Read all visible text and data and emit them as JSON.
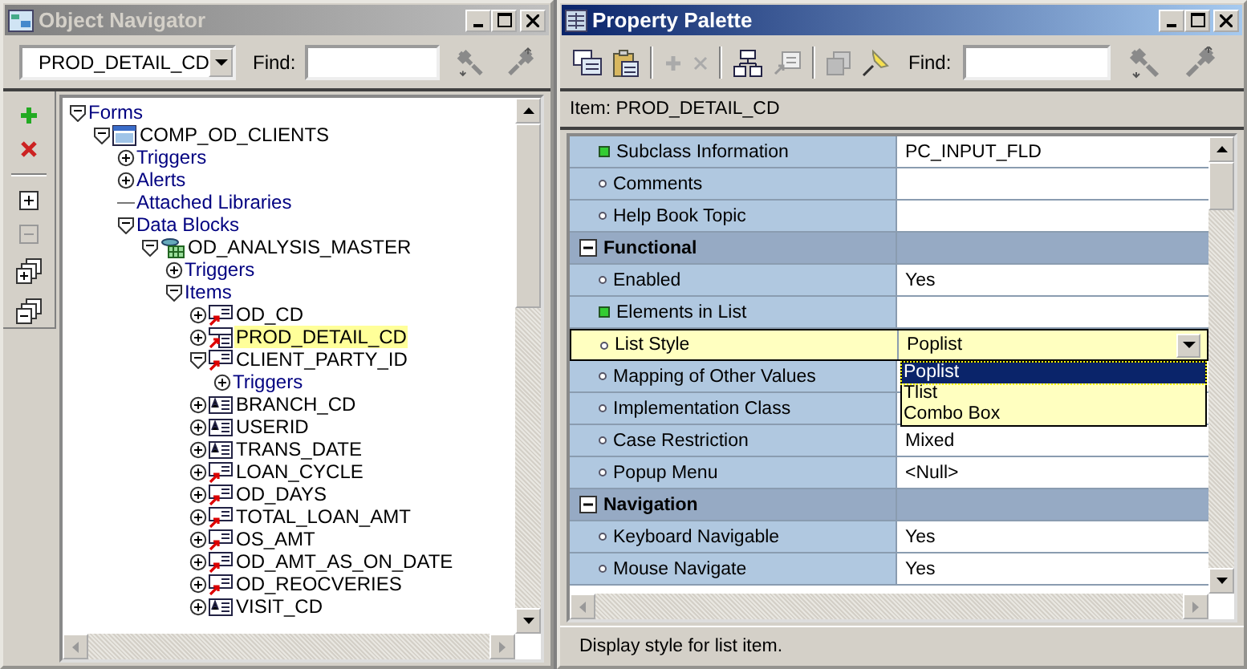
{
  "navigator": {
    "title": "Object Navigator",
    "active": false,
    "context": "PROD_DETAIL_CD",
    "find_label": "Find:",
    "tree": [
      {
        "kind": "category",
        "label": "Forms",
        "expanded": true,
        "children": [
          {
            "kind": "form",
            "label": "COMP_OD_CLIENTS",
            "expanded": true,
            "selected": false,
            "children": [
              {
                "kind": "category",
                "label": "Triggers",
                "expanded": false
              },
              {
                "kind": "category",
                "label": "Alerts",
                "expanded": false
              },
              {
                "kind": "category",
                "label": "Attached Libraries"
              },
              {
                "kind": "category",
                "label": "Data Blocks",
                "expanded": true,
                "children": [
                  {
                    "kind": "block",
                    "label": "OD_ANALYSIS_MASTER",
                    "expanded": true,
                    "selected": false,
                    "children": [
                      {
                        "kind": "category",
                        "label": "Triggers",
                        "expanded": false
                      },
                      {
                        "kind": "category",
                        "label": "Items",
                        "expanded": true,
                        "children": [
                          {
                            "kind": "subitem",
                            "label": "OD_CD",
                            "expanded": false,
                            "selected": false
                          },
                          {
                            "kind": "sublist",
                            "label": "PROD_DETAIL_CD",
                            "expanded": false,
                            "selected": true
                          },
                          {
                            "kind": "subitem",
                            "label": "CLIENT_PARTY_ID",
                            "expanded": true,
                            "selected": false,
                            "children": [
                              {
                                "kind": "category",
                                "label": "Triggers",
                                "expanded": false
                              }
                            ]
                          },
                          {
                            "kind": "item",
                            "label": "BRANCH_CD",
                            "expanded": false,
                            "selected": false
                          },
                          {
                            "kind": "item",
                            "label": "USERID",
                            "expanded": false,
                            "selected": false
                          },
                          {
                            "kind": "item",
                            "label": "TRANS_DATE",
                            "expanded": false,
                            "selected": false
                          },
                          {
                            "kind": "subitem",
                            "label": "LOAN_CYCLE",
                            "expanded": false,
                            "selected": false
                          },
                          {
                            "kind": "subitem",
                            "label": "OD_DAYS",
                            "expanded": false,
                            "selected": false
                          },
                          {
                            "kind": "subitem",
                            "label": "TOTAL_LOAN_AMT",
                            "expanded": false,
                            "selected": false
                          },
                          {
                            "kind": "subitem",
                            "label": "OS_AMT",
                            "expanded": false,
                            "selected": false
                          },
                          {
                            "kind": "subitem",
                            "label": "OD_AMT_AS_ON_DATE",
                            "expanded": false,
                            "selected": false
                          },
                          {
                            "kind": "subitem",
                            "label": "OD_REOCVERIES",
                            "expanded": false,
                            "selected": false
                          },
                          {
                            "kind": "item",
                            "label": "VISIT_CD",
                            "expanded": false,
                            "selected": false
                          }
                        ]
                      }
                    ]
                  }
                ]
              }
            ]
          }
        ]
      }
    ]
  },
  "palette": {
    "title": "Property Palette",
    "active": true,
    "find_label": "Find:",
    "item_label": "Item: PROD_DETAIL_CD",
    "rows": [
      {
        "kind": "property",
        "modified": true,
        "name": "Subclass Information",
        "value": "PC_INPUT_FLD",
        "selected": false
      },
      {
        "kind": "property",
        "modified": false,
        "name": "Comments",
        "selected": false
      },
      {
        "kind": "property",
        "modified": false,
        "name": "Help Book Topic",
        "selected": false
      },
      {
        "kind": "category",
        "name": "Functional",
        "expanded": true,
        "selected": false
      },
      {
        "kind": "property",
        "modified": false,
        "name": "Enabled",
        "value": "Yes",
        "selected": false
      },
      {
        "kind": "property",
        "modified": true,
        "name": "Elements in List",
        "selected": false
      },
      {
        "kind": "property",
        "modified": false,
        "name": "List Style",
        "value": "Poplist",
        "selected": true,
        "options": [
          {
            "label": "Poplist",
            "selected": true
          },
          {
            "label": "Tlist",
            "selected": false
          },
          {
            "label": "Combo Box",
            "selected": false
          }
        ]
      },
      {
        "kind": "property",
        "modified": false,
        "name": "Mapping of Other Values",
        "selected": false
      },
      {
        "kind": "property",
        "modified": false,
        "name": "Implementation Class",
        "selected": false
      },
      {
        "kind": "property",
        "modified": false,
        "name": "Case Restriction",
        "value": "Mixed",
        "selected": false
      },
      {
        "kind": "property",
        "modified": false,
        "name": "Popup Menu",
        "value": "<Null>",
        "selected": false
      },
      {
        "kind": "category",
        "name": "Navigation",
        "expanded": true,
        "selected": false
      },
      {
        "kind": "property",
        "modified": false,
        "name": "Keyboard Navigable",
        "value": "Yes",
        "selected": false
      },
      {
        "kind": "property",
        "modified": false,
        "name": "Mouse Navigate",
        "value": "Yes",
        "selected": false
      }
    ],
    "status": "Display style for list item."
  }
}
